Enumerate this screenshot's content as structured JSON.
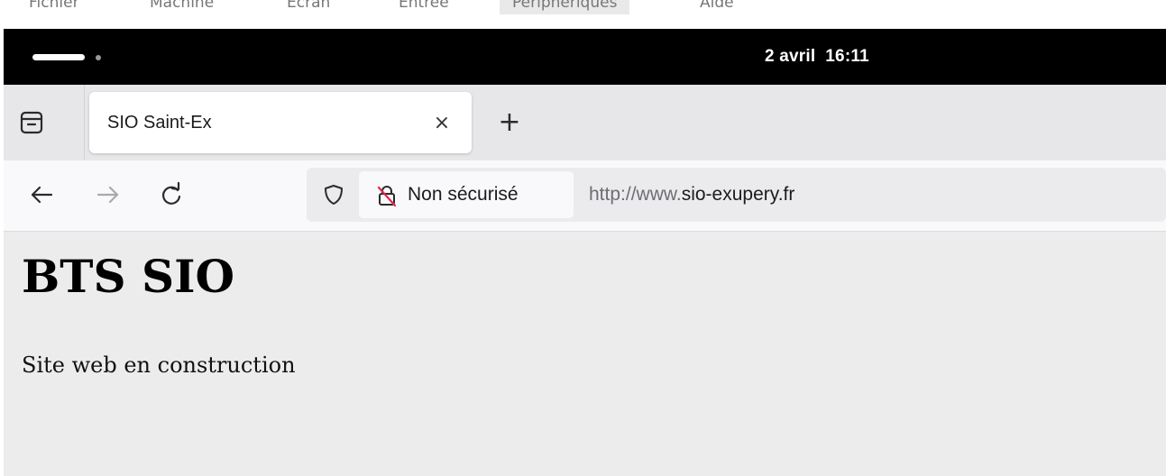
{
  "vm_menu": {
    "items": [
      "Fichier",
      "Machine",
      "Écran",
      "Entrée",
      "Périphériques",
      "Aide"
    ],
    "active_index": 4
  },
  "topbar": {
    "clock": "2 avril  16:11"
  },
  "browser": {
    "tabs": [
      {
        "title": "SIO Saint-Ex",
        "close_label": "×"
      }
    ],
    "new_tab_label": "+",
    "security_label": "Non sécurisé",
    "url_prefix": "http://www.",
    "url_domain": "sio-exupery.fr",
    "icons": {
      "tab_list": "tab-list-icon",
      "back": "back-arrow-icon",
      "forward": "forward-arrow-icon",
      "reload": "reload-icon",
      "shield": "tracking-protection-shield-icon",
      "lock": "insecure-lock-icon"
    }
  },
  "page": {
    "heading": "BTS SIO",
    "paragraph": "Site web en construction"
  }
}
